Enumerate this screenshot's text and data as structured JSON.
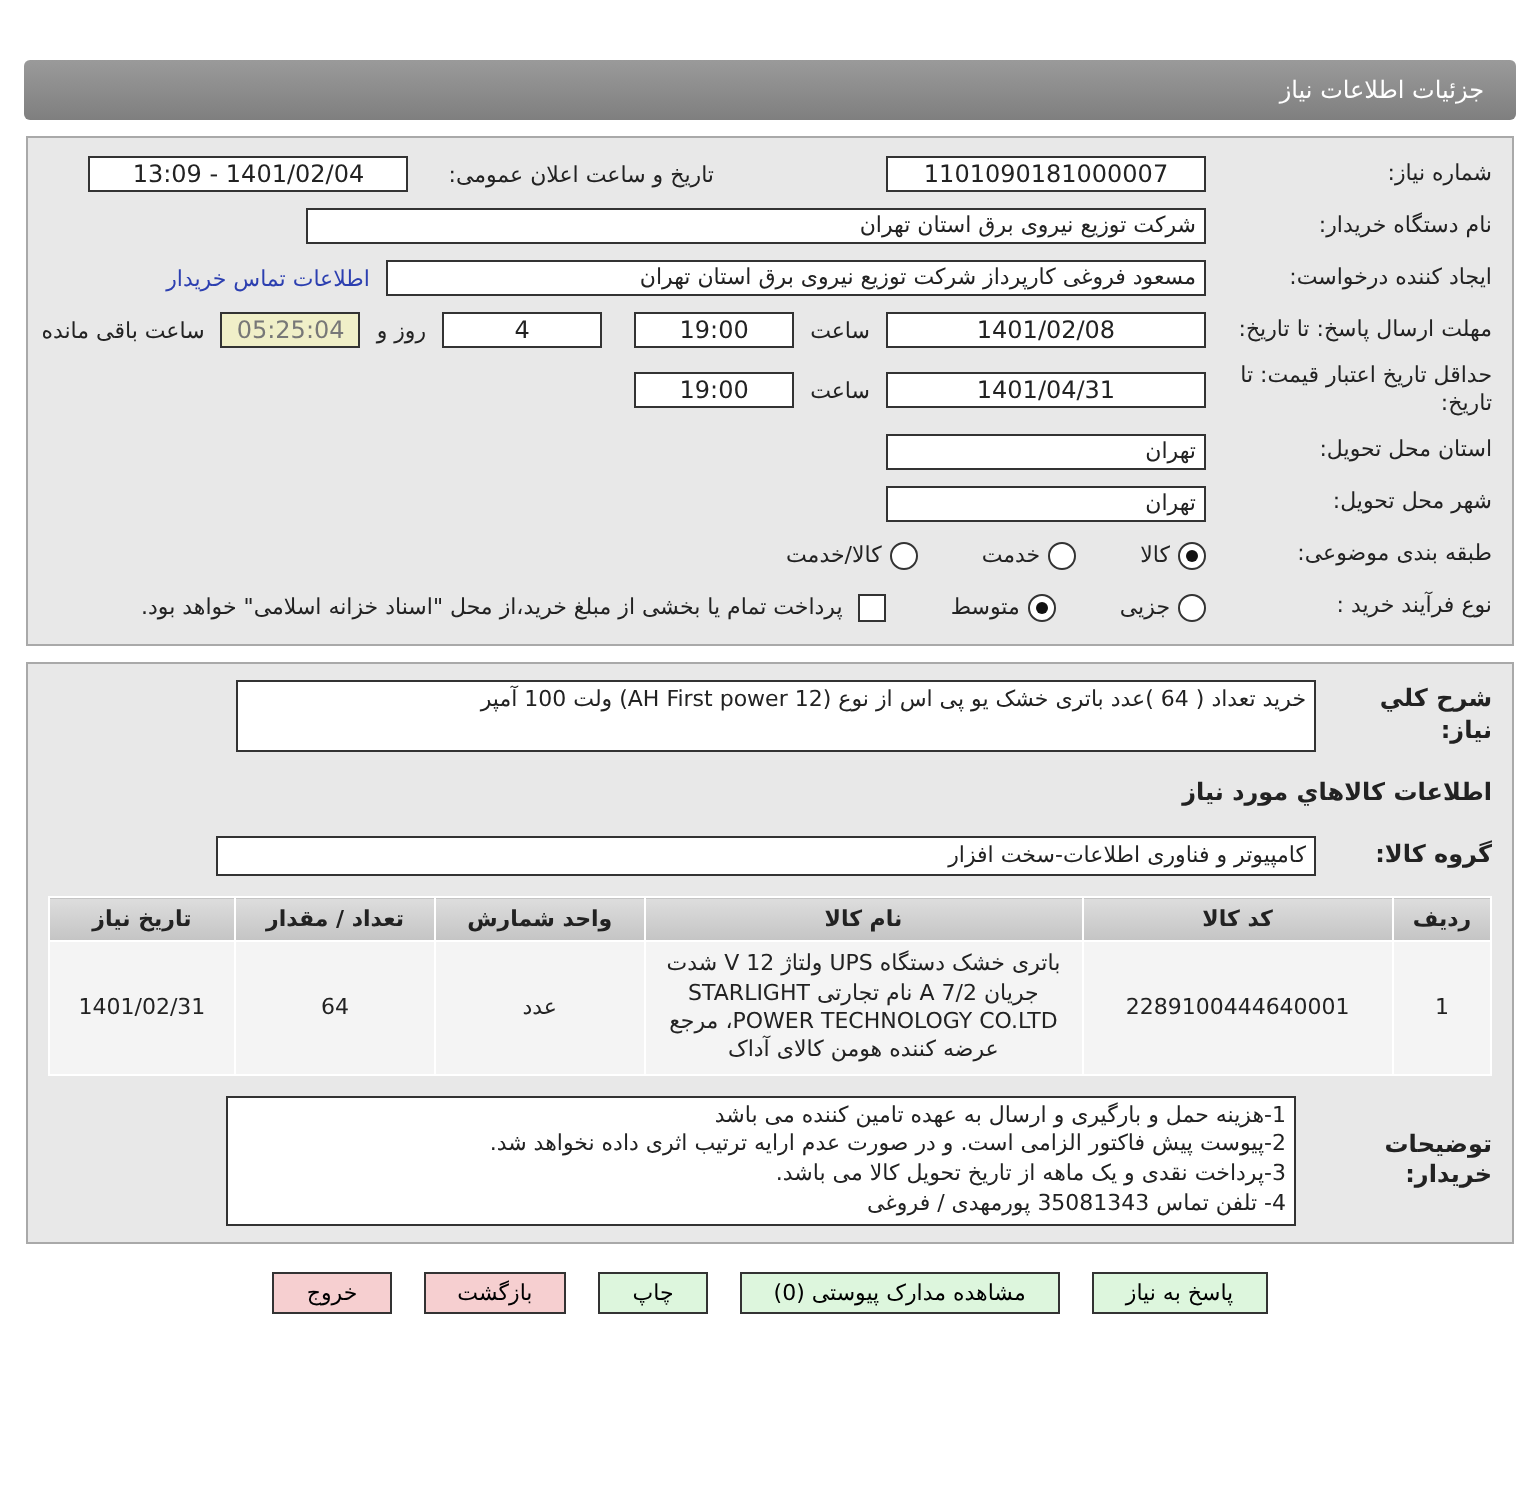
{
  "header": {
    "title": "جزئیات اطلاعات نیاز"
  },
  "details": {
    "need_number": {
      "label": "شماره نیاز:",
      "value": "1101090181000007"
    },
    "announce": {
      "label": "تاریخ و ساعت اعلان عمومی:",
      "value": "1401/02/04 - 13:09"
    },
    "buyer": {
      "label": "نام دستگاه خریدار:",
      "value": "شرکت توزیع نیروی برق استان تهران"
    },
    "requester": {
      "label": "ایجاد کننده درخواست:",
      "value": "مسعود فروغی کارپرداز شرکت توزیع نیروی برق استان تهران",
      "link": "اطلاعات تماس خریدار"
    },
    "deadline": {
      "label": "مهلت ارسال پاسخ: تا تاریخ:",
      "date": "1401/02/08",
      "time_label": "ساعت",
      "time": "19:00",
      "days": "4",
      "days_label": "روز و",
      "remaining": "05:25:04",
      "remaining_label": "ساعت باقی مانده"
    },
    "validity": {
      "label": "حداقل تاریخ اعتبار قیمت: تا تاریخ:",
      "date": "1401/04/31",
      "time_label": "ساعت",
      "time": "19:00"
    },
    "province": {
      "label": "استان محل تحویل:",
      "value": "تهران"
    },
    "city": {
      "label": "شهر محل تحویل:",
      "value": "تهران"
    },
    "category": {
      "label": "طبقه بندی موضوعی:",
      "options": [
        {
          "label": "کالا",
          "selected": true
        },
        {
          "label": "خدمت",
          "selected": false
        },
        {
          "label": "کالا/خدمت",
          "selected": false
        }
      ]
    },
    "process": {
      "label": "نوع فرآیند خرید :",
      "options": [
        {
          "label": "جزیی",
          "selected": false
        },
        {
          "label": "متوسط",
          "selected": true
        }
      ],
      "payment": {
        "label": "پرداخت تمام یا بخشی از مبلغ خرید،از محل \"اسناد خزانه اسلامی\" خواهد بود.",
        "checked": false
      }
    }
  },
  "goods": {
    "description": {
      "label": "شرح کلي نياز:",
      "value": "خرید تعداد ( 64 )عدد باتری خشک یو پی اس از نوع (12 AH First power) ولت 100 آمپر"
    },
    "heading": "اطلاعات کالاهاي مورد نياز",
    "group": {
      "label": "گروه کالا:",
      "value": "کامپیوتر و فناوری اطلاعات-سخت افزار"
    },
    "table": {
      "columns": [
        "ردیف",
        "کد کالا",
        "نام کالا",
        "واحد شمارش",
        "تعداد / مقدار",
        "تاریخ نیاز"
      ],
      "rows": [
        [
          "1",
          "2289100444640001",
          "باتری خشک دستگاه UPS ولتاژ 12 V شدت جریان 7/2 A نام تجارتی STARLIGHT POWER TECHNOLOGY CO.LTD، مرجع عرضه کننده هومن کالای آداک",
          "عدد",
          "64",
          "1401/02/31"
        ]
      ]
    },
    "notes": {
      "label": "توضیحات خریدار:",
      "lines": [
        "1-هزینه حمل و بارگیری و ارسال به عهده تامین کننده می باشد",
        "2-پیوست پیش فاکتور الزامی است. و در صورت عدم ارایه ترتیب اثری داده نخواهد شد.",
        "3-پرداخت نقدی و یک ماهه از تاریخ تحویل کالا می باشد.",
        "4- تلفن تماس 35081343  پورمهدی / فروغی"
      ]
    }
  },
  "buttons": [
    {
      "label": "پاسخ به نیاز",
      "kind": "action"
    },
    {
      "label": "مشاهده مدارک پیوستی (0)",
      "kind": "action"
    },
    {
      "label": "چاپ",
      "kind": "action"
    },
    {
      "label": "بازگشت",
      "kind": "danger"
    },
    {
      "label": "خروج",
      "kind": "danger"
    }
  ]
}
